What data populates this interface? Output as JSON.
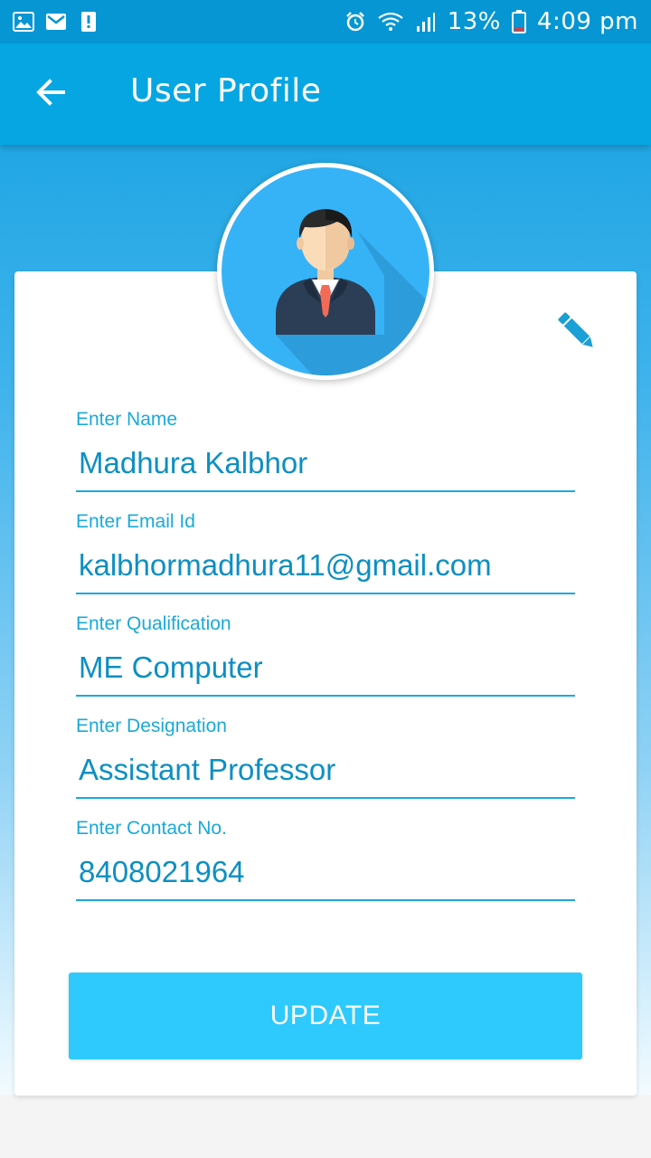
{
  "status_bar": {
    "left_icons": [
      "image-icon",
      "gmail-icon",
      "alert-icon"
    ],
    "right_icons": [
      "alarm-icon",
      "wifi-icon",
      "signal-icon",
      "battery-icon"
    ],
    "battery_text": "13%",
    "time": "4:09 pm"
  },
  "app_bar": {
    "title": "User Profile",
    "back_icon": "arrow-left-icon"
  },
  "profile": {
    "avatar_icon": "user-avatar-icon",
    "edit_icon": "pencil-icon"
  },
  "fields": [
    {
      "label": "Enter Name",
      "value": "Madhura Kalbhor"
    },
    {
      "label": "Enter Email Id",
      "value": "kalbhormadhura11@gmail.com"
    },
    {
      "label": "Enter Qualification",
      "value": "ME Computer"
    },
    {
      "label": "Enter Designation",
      "value": "Assistant Professor"
    },
    {
      "label": "Enter Contact No.",
      "value": "8408021964"
    }
  ],
  "actions": {
    "update_label": "UPDATE"
  },
  "colors": {
    "primary": "#06a6e2",
    "status_bar": "#0596d3",
    "accent_text": "#1aa9db",
    "button": "#2ec9fd"
  }
}
